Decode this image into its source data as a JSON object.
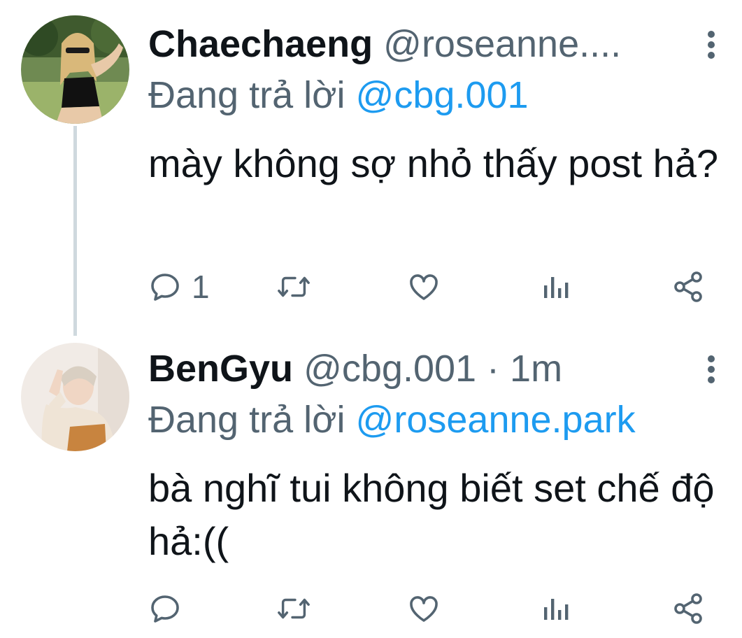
{
  "thread": [
    {
      "display_name": "Chaechaeng",
      "handle": "@roseanne....",
      "reply_prefix": "Đang trả lời",
      "reply_to": "@cbg.001",
      "text": "mày không sợ nhỏ thấy post hả?",
      "reply_count": "1",
      "avatar_icon": "avatar-photo-woman"
    },
    {
      "display_name": "BenGyu",
      "handle": "@cbg.001 · 1m",
      "reply_prefix": "Đang trả lời",
      "reply_to": "@roseanne.park",
      "text": "bà nghĩ tui không biết set chế độ hả:((",
      "reply_count": "",
      "avatar_icon": "avatar-photo-man"
    }
  ],
  "colors": {
    "text_primary": "#0f1419",
    "text_secondary": "#536471",
    "mention": "#1d9bf0",
    "thread_line": "#cfd9de"
  },
  "icons": [
    "reply-icon",
    "retweet-icon",
    "like-icon",
    "stats-icon",
    "share-icon",
    "more-icon"
  ]
}
